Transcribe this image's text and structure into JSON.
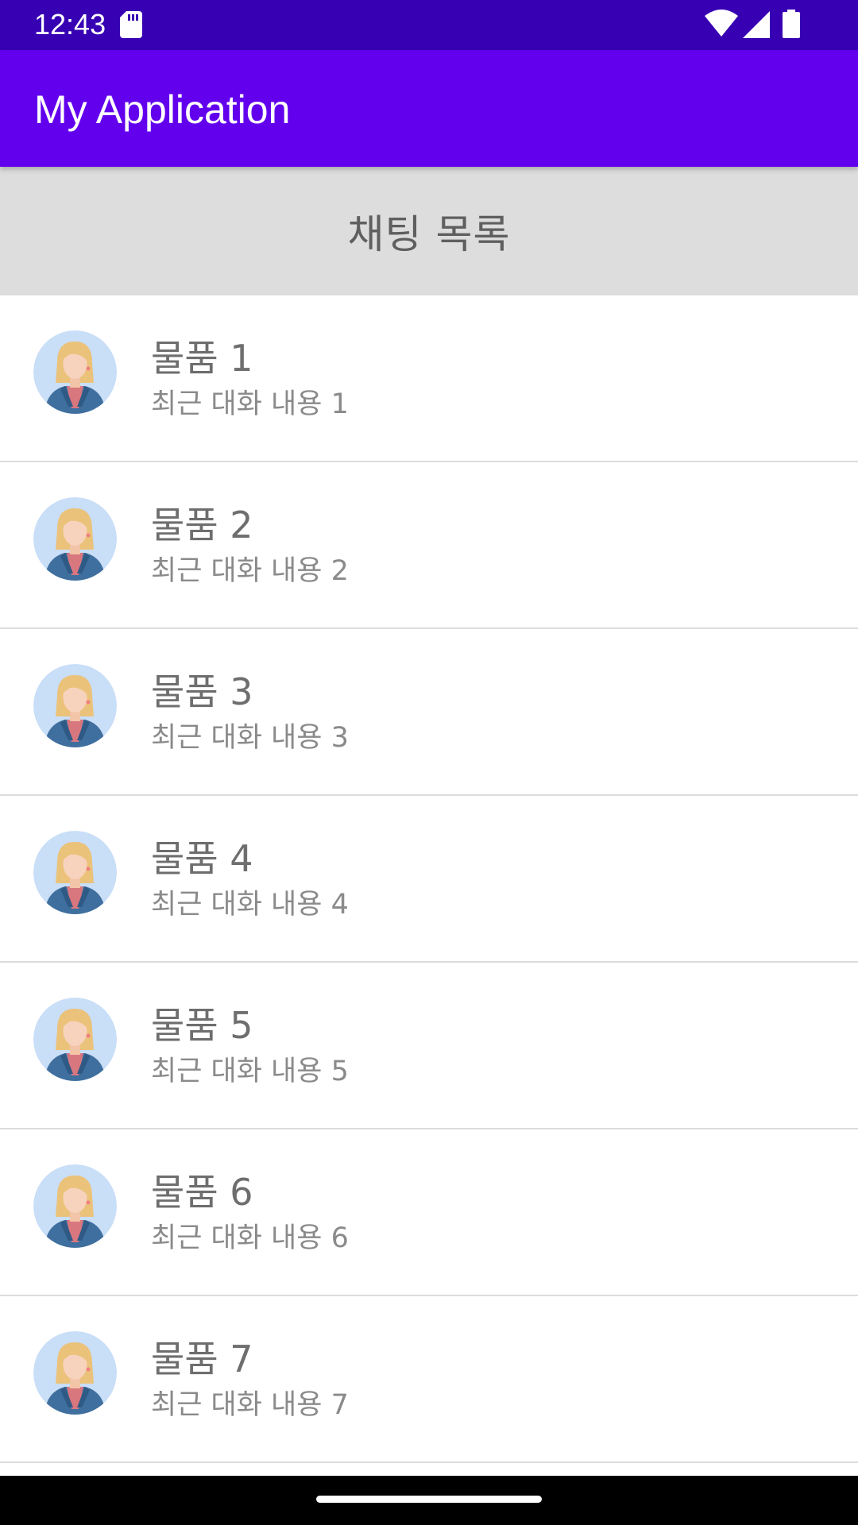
{
  "status_bar": {
    "time": "12:43",
    "icons": [
      "sd-card-icon",
      "wifi-icon",
      "signal-icon",
      "battery-icon"
    ],
    "color": "#3700B3"
  },
  "app_bar": {
    "title": "My Application",
    "color": "#6200EE"
  },
  "section": {
    "title": "채팅 목록",
    "background": "#DDDDDD"
  },
  "chat_list": [
    {
      "name": "물품 1",
      "message": "최근 대화 내용 1",
      "avatar": "user-avatar-icon"
    },
    {
      "name": "물품 2",
      "message": "최근 대화 내용 2",
      "avatar": "user-avatar-icon"
    },
    {
      "name": "물품 3",
      "message": "최근 대화 내용 3",
      "avatar": "user-avatar-icon"
    },
    {
      "name": "물품 4",
      "message": "최근 대화 내용 4",
      "avatar": "user-avatar-icon"
    },
    {
      "name": "물품 5",
      "message": "최근 대화 내용 5",
      "avatar": "user-avatar-icon"
    },
    {
      "name": "물품 6",
      "message": "최근 대화 내용 6",
      "avatar": "user-avatar-icon"
    },
    {
      "name": "물품 7",
      "message": "최근 대화 내용 7",
      "avatar": "user-avatar-icon"
    }
  ]
}
